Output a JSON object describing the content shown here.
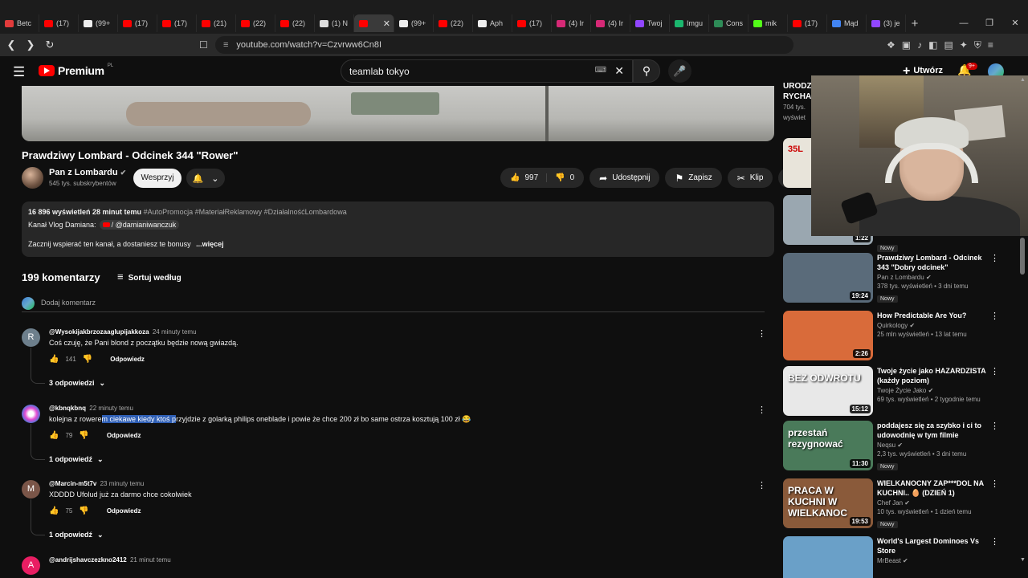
{
  "browser": {
    "tabs": [
      {
        "label": "Betc",
        "color": "#e23b3b"
      },
      {
        "label": "(17)",
        "color": "#ff0000"
      },
      {
        "label": "(99+",
        "color": "#eeeeee"
      },
      {
        "label": "(17)",
        "color": "#ff0000"
      },
      {
        "label": "(17)",
        "color": "#ff0000"
      },
      {
        "label": "(21)",
        "color": "#ff0000"
      },
      {
        "label": "(22)",
        "color": "#ff0000"
      },
      {
        "label": "(22)",
        "color": "#ff0000"
      },
      {
        "label": "(1) N",
        "color": "#dddddd"
      },
      {
        "label": "",
        "color": "#ff0000",
        "active": true
      },
      {
        "label": "(99+",
        "color": "#eeeeee"
      },
      {
        "label": "(22)",
        "color": "#ff0000"
      },
      {
        "label": "Aph",
        "color": "#eeeeee"
      },
      {
        "label": "(17)",
        "color": "#ff0000"
      },
      {
        "label": "(4) Ir",
        "color": "#d62976"
      },
      {
        "label": "(4) Ir",
        "color": "#d62976"
      },
      {
        "label": "Twoj",
        "color": "#9146ff"
      },
      {
        "label": "Imgu",
        "color": "#1bb76e"
      },
      {
        "label": "Cons",
        "color": "#2e8b57"
      },
      {
        "label": "mik",
        "color": "#53fc18"
      },
      {
        "label": "(17)",
        "color": "#ff0000"
      },
      {
        "label": "Mąd",
        "color": "#4285f4"
      },
      {
        "label": "(3) je",
        "color": "#9146ff"
      }
    ],
    "url": "youtube.com/watch?v=Czvrww6Cn8I"
  },
  "header": {
    "logo_text": "Premium",
    "region": "PL",
    "search_value": "teamlab tokyo",
    "create_label": "Utwórz",
    "notifications": "9+"
  },
  "video": {
    "title": "Prawdziwy Lombard - Odcinek 344 \"Rower\"",
    "channel": "Pan z Lombardu",
    "subscribers": "545 tys. subskrybentów",
    "support_label": "Wesprzyj",
    "likes": "997",
    "dislikes": "0",
    "share_label": "Udostępnij",
    "save_label": "Zapisz",
    "clip_label": "Klip"
  },
  "description": {
    "meta": "16 896 wyświetleń  28 minut temu",
    "tags": "#AutoPromocja #MateriałReklamowy #DziałalnośćLombardowa",
    "line2_prefix": "Kanał Vlog Damiana:",
    "line2_chip": "/ @damianiwanczuk",
    "line3": "Zacznij wspierać ten kanał, a dostaniesz te bonusy",
    "more": "...więcej"
  },
  "comments_section": {
    "count": "199 komentarzy",
    "sort_label": "Sortuj według",
    "add_placeholder": "Dodaj komentarz",
    "reply_label": "Odpowiedz",
    "items": [
      {
        "avatar_letter": "R",
        "avatar_color": "#6d7f8c",
        "author": "@Wysokijakbrzozaaglupijakkoza",
        "time": "24 minuty temu",
        "text": "Coś czuję, że Pani blond z początku będzie nową gwiazdą.",
        "likes": "141",
        "replies": "3 odpowiedzi"
      },
      {
        "avatar_letter": "",
        "avatar_color": "#c44bd6",
        "author": "@kbnqkbnq",
        "time": "22 minuty temu",
        "text_before": "kolejna z rowere",
        "text_highlight": "m ciekawe kiedy ktoś p",
        "text_after": "rzyjdzie z golarką philips oneblade i powie że chce 200 zł bo same ostrza kosztują 100 zł 😂",
        "likes": "79",
        "replies": "1 odpowiedź"
      },
      {
        "avatar_letter": "M",
        "avatar_color": "#7a5548",
        "author": "@Marcin-m5t7v",
        "time": "23 minuty temu",
        "text": "XDDDD Ufolud już za darmo chce cokolwiek",
        "likes": "75",
        "replies": "1 odpowiedź"
      },
      {
        "avatar_letter": "A",
        "avatar_color": "#e91e63",
        "author": "@andrijshavczezkno2412",
        "time": "21 minut temu"
      }
    ]
  },
  "sidebar": {
    "top_title_1": "URODZ",
    "top_title_2": "RYCHA",
    "top_views": "704 tys.",
    "top_meta": "wyświet",
    "items": [
      {
        "title": "Prawdziwy Lombard - Odcinek 343 \"Dobry odcinek\"",
        "channel": "Pan z Lombardu",
        "meta": "378 tys. wyświetleń • 3 dni temu",
        "badge": "Nowy",
        "duration": "19:24",
        "bg": "#5a6b7a"
      },
      {
        "title": "How Predictable Are You?",
        "channel": "Quirkology",
        "meta": "25 mln wyświetleń • 13 lat temu",
        "duration": "2:26",
        "bg": "#d96b3a"
      },
      {
        "title": "Twoje życie jako HAZARDZISTA (każdy poziom)",
        "channel": "Twoje Życie Jako",
        "meta": "69 tys. wyświetleń • 2 tygodnie temu",
        "duration": "15:12",
        "caption": "BEZ ODWROTU",
        "bg": "#e8e8e8"
      },
      {
        "title": "poddajesz się za szybko i ci to udowodnię w tym filmie",
        "channel": "Neqsu",
        "meta": "2,3 tys. wyświetleń • 3 dni temu",
        "badge": "Nowy",
        "duration": "11:30",
        "caption": "przestań rezygnować",
        "bg": "#4a7a5a"
      },
      {
        "title": "WIELKANOCNY ZAP***DOL NA KUCHNI.. 🥚 (DZIEŃ 1)",
        "channel": "Chef Jan",
        "meta": "10 tys. wyświetleń • 1 dzień temu",
        "badge": "Nowy",
        "duration": "19:53",
        "caption": "PRACA W KUCHNI W WIELKANOC",
        "bg": "#8a5a3a"
      },
      {
        "title": "World's Largest Dominoes Vs Store",
        "channel": "MrBeast",
        "meta": "",
        "duration": "",
        "bg": "#6aa0c8"
      }
    ],
    "partial_duration": "1:22",
    "partial_badge": "Nowy",
    "partial_caption": "35L"
  }
}
